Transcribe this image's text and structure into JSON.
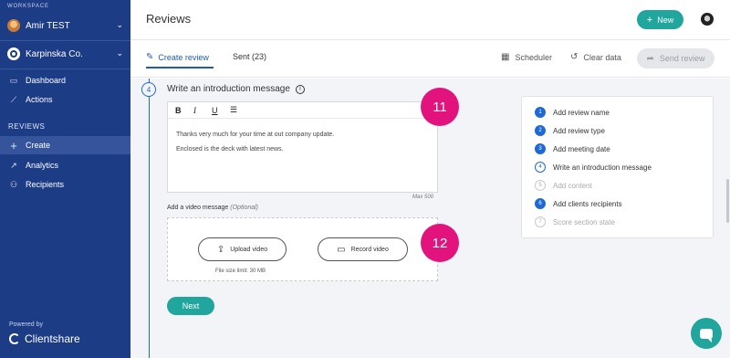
{
  "sidebar": {
    "workspace_label": "WORKSPACE",
    "workspaces": [
      {
        "name": "Amir TEST",
        "icon": "user-avatar-icon"
      },
      {
        "name": "Karpinska Co.",
        "icon": "company-logo-icon"
      }
    ],
    "chevron": "⌄",
    "nav_top": [
      {
        "label": "Dashboard",
        "icon": "dashboard-icon",
        "glyph": "▭"
      },
      {
        "label": "Actions",
        "icon": "actions-icon",
        "glyph": "⟋"
      }
    ],
    "section_label": "REVIEWS",
    "nav_reviews": [
      {
        "label": "Create",
        "icon": "plus-icon",
        "glyph": "+"
      },
      {
        "label": "Analytics",
        "icon": "analytics-icon",
        "glyph": "↗"
      },
      {
        "label": "Recipients",
        "icon": "recipients-icon",
        "glyph": "⚇"
      }
    ],
    "powered_by": "Powered by",
    "brand": "Clientshare"
  },
  "header": {
    "title": "Reviews",
    "new_label": "New",
    "new_glyph": "+"
  },
  "tabs": {
    "create_label": "Create review",
    "create_glyph": "✎",
    "sent_label": "Sent (23)",
    "scheduler_label": "Scheduler",
    "scheduler_glyph": "▦",
    "clear_label": "Clear data",
    "clear_glyph": "↺",
    "send_label": "Send review",
    "send_glyph": "➦"
  },
  "step": {
    "number": "4",
    "title": "Write an introduction message",
    "info_glyph": "i"
  },
  "editor": {
    "toolbar": {
      "bold": "B",
      "italic": "I",
      "underline": "U",
      "list": "☰"
    },
    "line1": "Thanks very much for your time at out company update.",
    "line2": "Enclosed is the deck with latest news.",
    "max_label": "Max 500"
  },
  "video": {
    "label": "Add a video message",
    "optional": "(Optional)",
    "upload_label": "Upload video",
    "upload_glyph": "⇪",
    "record_label": "Record video",
    "record_glyph": "▭",
    "limit": "File size limit: 30 MB"
  },
  "next_label": "Next",
  "callouts": [
    "11",
    "12"
  ],
  "colors": {
    "sidebar": "#1d3c86",
    "accent": "#21a69d",
    "primary_blue": "#1e6ad2",
    "callout": "#e3137e"
  },
  "steps_list": [
    {
      "num": "1",
      "label": "Add review name",
      "state": "done"
    },
    {
      "num": "2",
      "label": "Add review type",
      "state": "done"
    },
    {
      "num": "3",
      "label": "Add meeting date",
      "state": "done"
    },
    {
      "num": "4",
      "label": "Write an introduction message",
      "state": "current"
    },
    {
      "num": "5",
      "label": "Add content",
      "state": "todo"
    },
    {
      "num": "6",
      "label": "Add clients recipients",
      "state": "done"
    },
    {
      "num": "7",
      "label": "Score section state",
      "state": "todo"
    }
  ]
}
